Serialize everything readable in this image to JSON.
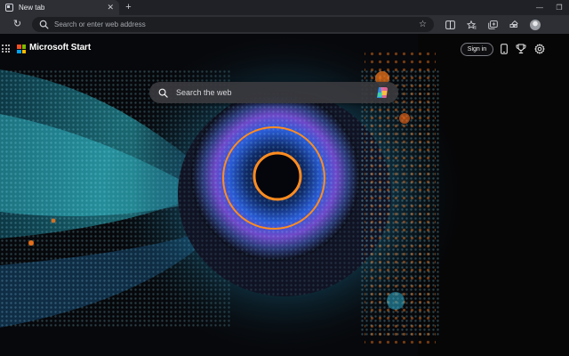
{
  "browser": {
    "tab": {
      "title": "New tab",
      "close_icon": "close-icon",
      "favicon": "newtab-page-icon"
    },
    "new_tab_icon": "plus-icon",
    "window_controls": {
      "minimize": "minimize-icon",
      "maximize": "maximize-icon"
    },
    "toolbar": {
      "reload_icon": "reload-icon",
      "address_placeholder": "Search or enter web address",
      "address_value": "",
      "favorite_icon": "star-icon",
      "icons": [
        "split-screen-icon",
        "favorites-icon",
        "collections-icon",
        "extensions-icon",
        "profile-avatar"
      ]
    }
  },
  "page": {
    "brand": {
      "name": "Microsoft Start",
      "logo_colors": [
        "#f25022",
        "#7fba00",
        "#00a4ef",
        "#ffb900"
      ]
    },
    "header": {
      "sign_in_label": "Sign in",
      "icons": [
        "phone-icon",
        "rewards-trophy-icon",
        "settings-gear-icon"
      ]
    },
    "search": {
      "placeholder": "Search the web",
      "value": "",
      "copilot_icon": "copilot-icon"
    },
    "background": {
      "subject": "digital eye artwork",
      "accent": "#ff7a1a",
      "ring": "#ff8c1f",
      "glow": "#3fd6e6"
    }
  },
  "colors": {
    "tabstrip": "#1f2126",
    "toolbar": "#2d2f35",
    "address_bar": "#1c1e22",
    "search_box": "#3a3a3e"
  }
}
